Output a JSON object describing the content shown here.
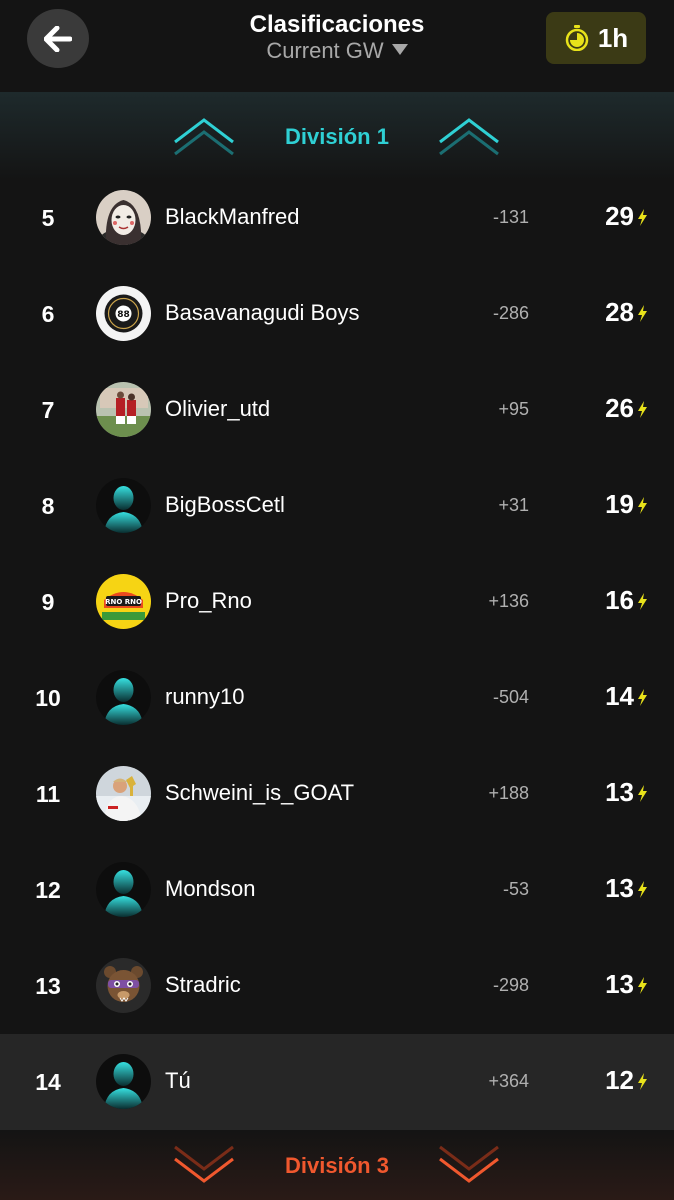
{
  "header": {
    "title": "Clasificaciones",
    "subtitle": "Current GW",
    "timer": "1h"
  },
  "colors": {
    "background": "#141414",
    "promotion": "#2fd0d4",
    "relegation": "#f0582e",
    "timer_bg": "#3b3a15",
    "timer_icon": "#e8e21a",
    "bolt": "#e8e21a",
    "current_user_row": "#262626"
  },
  "division_up": {
    "label": "División 1",
    "icon": "double-chevron-up-icon"
  },
  "division_down": {
    "label": "División 3",
    "icon": "double-chevron-down-icon"
  },
  "rows": [
    {
      "rank": "5",
      "name": "BlackManfred",
      "delta": "-131",
      "points": "29",
      "avatar": "masked-face-avatar"
    },
    {
      "rank": "6",
      "name": "Basavanagudi Boys",
      "delta": "-286",
      "points": "28",
      "avatar": "team-badge-avatar"
    },
    {
      "rank": "7",
      "name": "Olivier_utd",
      "delta": "+95",
      "points": "26",
      "avatar": "football-photo-avatar"
    },
    {
      "rank": "8",
      "name": "BigBossCetl",
      "delta": "+31",
      "points": "19",
      "avatar": "default-silhouette-avatar"
    },
    {
      "rank": "9",
      "name": "Pro_Rno",
      "delta": "+136",
      "points": "16",
      "avatar": "yellow-logo-avatar"
    },
    {
      "rank": "10",
      "name": "runny10",
      "delta": "-504",
      "points": "14",
      "avatar": "default-silhouette-avatar"
    },
    {
      "rank": "11",
      "name": "Schweini_is_GOAT",
      "delta": "+188",
      "points": "13",
      "avatar": "trophy-photo-avatar"
    },
    {
      "rank": "12",
      "name": "Mondson",
      "delta": "-53",
      "points": "13",
      "avatar": "default-silhouette-avatar"
    },
    {
      "rank": "13",
      "name": "Stradric",
      "delta": "-298",
      "points": "13",
      "avatar": "cartoon-bear-avatar"
    },
    {
      "rank": "14",
      "name": "Tú",
      "delta": "+364",
      "points": "12",
      "avatar": "default-silhouette-avatar",
      "current_user": true
    }
  ]
}
